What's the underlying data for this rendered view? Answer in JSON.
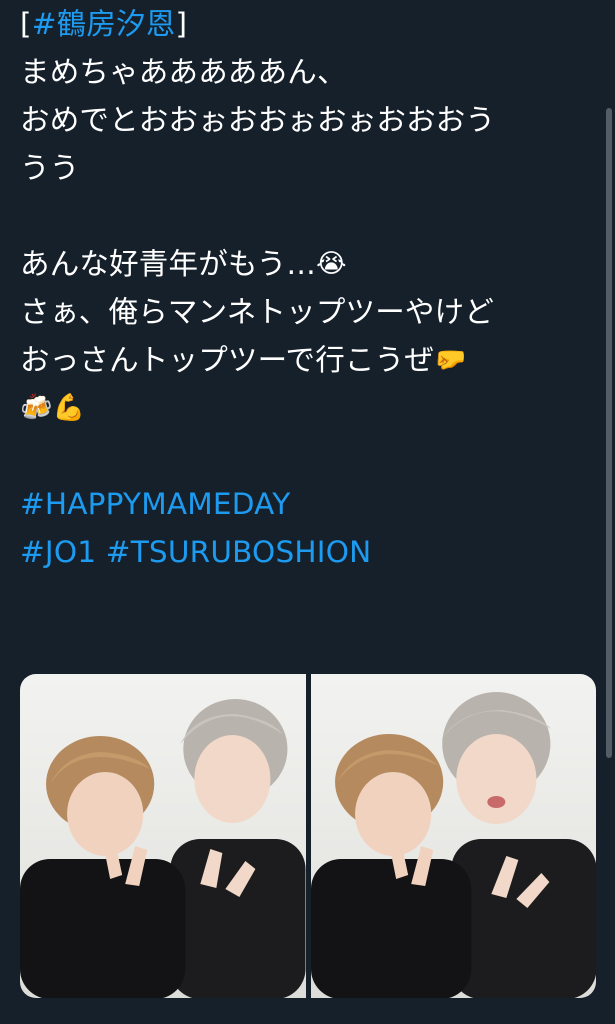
{
  "tweet": {
    "lines": [
      {
        "parts": [
          {
            "t": "[",
            "link": false
          },
          {
            "t": "#鶴房汐恩",
            "link": true
          },
          {
            "t": "]",
            "link": false
          }
        ]
      },
      {
        "parts": [
          {
            "t": "まめちゃあああああん、",
            "link": false
          }
        ]
      },
      {
        "parts": [
          {
            "t": "おめでとおおぉおおぉおぉおおおう",
            "link": false
          }
        ]
      },
      {
        "parts": [
          {
            "t": "うう",
            "link": false
          }
        ]
      },
      {
        "parts": []
      },
      {
        "parts": [
          {
            "t": "あんな好青年がもう…",
            "link": false
          },
          {
            "emoji": "😭"
          }
        ]
      },
      {
        "parts": [
          {
            "t": "さぁ、俺らマンネトップツーやけど",
            "link": false
          }
        ]
      },
      {
        "parts": [
          {
            "t": "おっさんトップツーで行こうぜ",
            "link": false
          },
          {
            "emoji": "🤛"
          }
        ]
      },
      {
        "parts": [
          {
            "emoji": "🍻"
          },
          {
            "emoji": "💪"
          }
        ]
      },
      {
        "parts": []
      },
      {
        "parts": [
          {
            "t": "#HAPPYMAMEDAY",
            "link": true
          }
        ]
      },
      {
        "parts": [
          {
            "t": "#JO1",
            "link": true
          },
          {
            "t": " ",
            "link": false
          },
          {
            "t": "#TSURUBOSHION",
            "link": true
          }
        ]
      }
    ]
  },
  "media": {
    "photos": [
      {
        "name": "photo-left",
        "alt": ""
      },
      {
        "name": "photo-right",
        "alt": ""
      }
    ]
  },
  "colors": {
    "background": "#15202b",
    "text": "#ffffff",
    "link": "#1d9bf0"
  }
}
